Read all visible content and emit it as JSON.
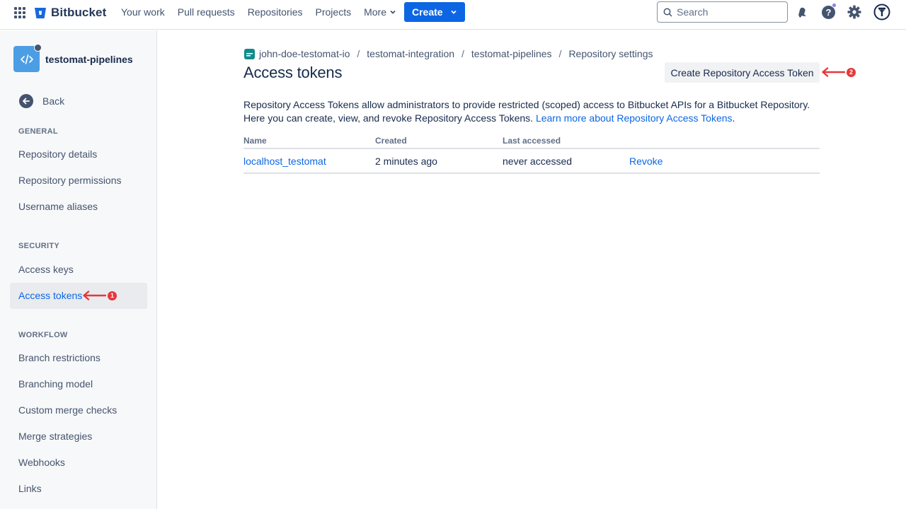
{
  "nav": {
    "brand": "Bitbucket",
    "links": [
      "Your work",
      "Pull requests",
      "Repositories",
      "Projects"
    ],
    "more_label": "More",
    "create_label": "Create",
    "search_placeholder": "Search",
    "icons": [
      "notifications-icon",
      "help-icon",
      "settings-icon",
      "profile-avatar"
    ]
  },
  "sidebar": {
    "repo_name": "testomat-pipelines",
    "back_label": "Back",
    "sections": {
      "general": "GENERAL",
      "security": "SECURITY",
      "workflow": "WORKFLOW"
    },
    "general_items": [
      "Repository details",
      "Repository permissions",
      "Username aliases"
    ],
    "security_items": [
      "Access keys",
      "Access tokens"
    ],
    "workflow_items": [
      "Branch restrictions",
      "Branching model",
      "Custom merge checks",
      "Merge strategies",
      "Webhooks",
      "Links"
    ],
    "active_item": "Access tokens"
  },
  "annotations": {
    "first": "1",
    "second": "2",
    "color": "#e5383b"
  },
  "main": {
    "breadcrumb": [
      "john-doe-testomat-io",
      "testomat-integration",
      "testomat-pipelines",
      "Repository settings"
    ],
    "title": "Access tokens",
    "create_button": "Create Repository Access Token",
    "description": "Repository Access Tokens allow administrators to provide restricted (scoped) access to Bitbucket APIs for a Bitbucket Repository. Here you can create, view, and revoke Repository Access Tokens.",
    "learn_more": "Learn more about Repository Access Tokens",
    "table": {
      "headers": [
        "Name",
        "Created",
        "Last accessed"
      ],
      "rows": [
        {
          "name": "localhost_testomat",
          "created": "2 minutes ago",
          "last_accessed": "never accessed",
          "action": "Revoke"
        }
      ]
    }
  },
  "colors": {
    "brand_blue": "#0c66e4",
    "text": "#172b4d",
    "subtle": "#44546f"
  }
}
